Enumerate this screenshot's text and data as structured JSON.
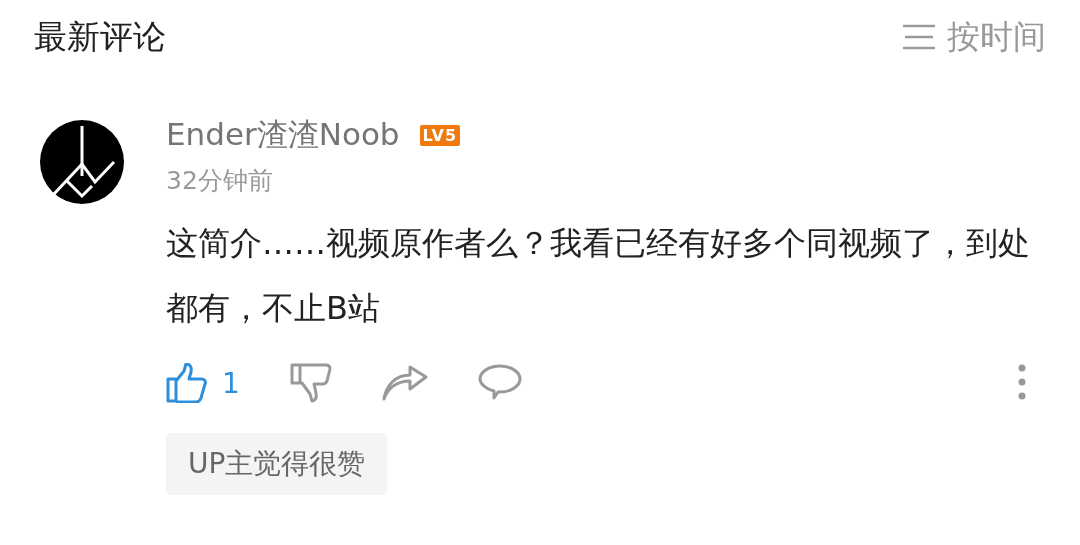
{
  "header": {
    "title": "最新评论",
    "sort_label": "按时间"
  },
  "comment": {
    "user": "Ender渣渣Noob",
    "level": "LV5",
    "time": "32分钟前",
    "text": "这简介……视频原作者么？我看已经有好多个同视频了，到处都有，不止B站",
    "likes": "1",
    "liked": true,
    "disliked": false,
    "tag": "UP主觉得很赞"
  }
}
